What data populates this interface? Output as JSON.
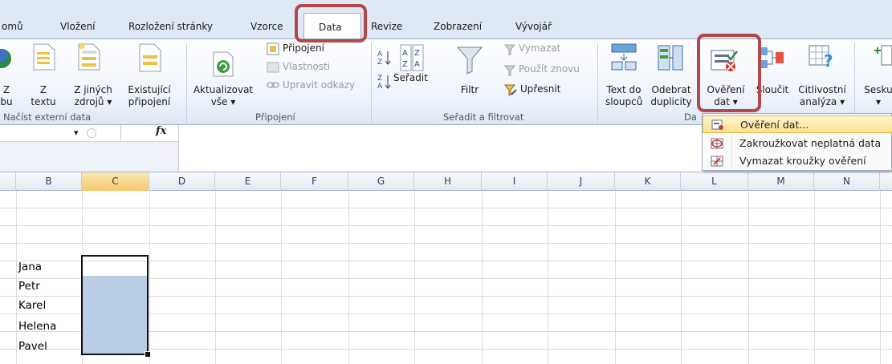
{
  "tabs": [
    "omů",
    "Vložení",
    "Rozložení stránky",
    "Vzorce",
    "Data",
    "Revize",
    "Zobrazení",
    "Vývojář"
  ],
  "ribbon": {
    "ext_group": {
      "label": "Načíst externí data",
      "access_top": "Z",
      "access_bottom": "bu",
      "text_top": "Z",
      "text_bottom": "textu",
      "other_top": "Z jiných",
      "other_bottom": "zdrojů ▾",
      "existing_top": "Existující",
      "existing_bottom": "připojení"
    },
    "conn_group": {
      "label": "Připojení",
      "refresh_top": "Aktualizovat",
      "refresh_bottom": "vše ▾",
      "connections": "Připojení",
      "properties": "Vlastnosti",
      "edit_links": "Upravit odkazy"
    },
    "sort_group": {
      "label": "Seřadit a filtrovat",
      "sort": "Seřadit",
      "filter": "Filtr",
      "clear": "Vymazat",
      "reapply": "Použít znovu",
      "advanced": "Upřesnit"
    },
    "tools_group": {
      "label": "Da",
      "text_cols_top": "Text do",
      "text_cols_bottom": "sloupců",
      "remove_dup_top": "Odebrat",
      "remove_dup_bottom": "duplicity",
      "validation_top": "Ověření",
      "validation_bottom": "dat ▾",
      "consolidate": "Sloučit",
      "whatif_top": "Citlivostní",
      "whatif_bottom": "analýza ▾"
    },
    "outline_group": {
      "group_label": "Sesku",
      "arrow": "▾"
    }
  },
  "formula_bar": {
    "fx": "fx",
    "dropdown": "▾"
  },
  "columns": [
    "B",
    "C",
    "D",
    "E",
    "F",
    "G",
    "H",
    "I",
    "J",
    "K",
    "L",
    "M",
    "N"
  ],
  "cells": {
    "b4": "Jana",
    "b5": "Petr",
    "b6": "Karel",
    "b7": "Helena",
    "b8": "Pavel"
  },
  "menu": {
    "items": [
      {
        "label": "Ověření dat..."
      },
      {
        "label": "Zakroužkovat neplatná data"
      },
      {
        "label": "Vymazat kroužky ověření"
      }
    ]
  },
  "colors": {
    "highlight": "#b4474a",
    "selection_fill": "#b8cce4",
    "ribbon_bg": "#dfe8f5"
  }
}
